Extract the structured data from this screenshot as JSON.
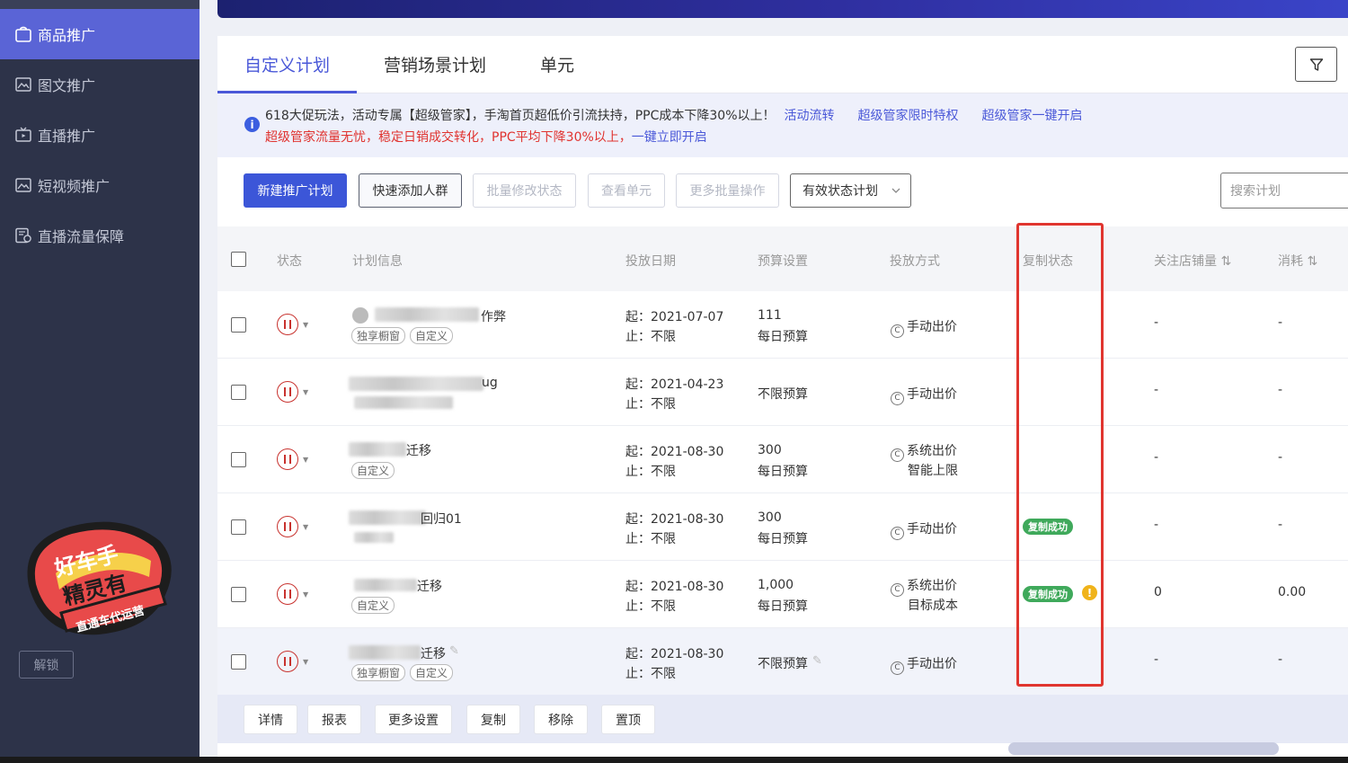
{
  "sidebar": {
    "items": [
      {
        "label": "商品推广",
        "icon": "bag-icon",
        "active": true
      },
      {
        "label": "图文推广",
        "icon": "image-icon",
        "active": false
      },
      {
        "label": "直播推广",
        "icon": "live-icon",
        "active": false
      },
      {
        "label": "短视频推广",
        "icon": "video-icon",
        "active": false
      },
      {
        "label": "直播流量保障",
        "icon": "shield-doc-icon",
        "active": false
      }
    ],
    "sticker": {
      "line1": "好车手",
      "line2": "精灵有",
      "ribbon": "直通车代运营"
    },
    "unlock_label": "解锁"
  },
  "tabs": [
    {
      "label": "自定义计划",
      "active": true
    },
    {
      "label": "营销场景计划",
      "active": false
    },
    {
      "label": "单元",
      "active": false
    }
  ],
  "notice": {
    "line1_text": "618大促玩法，活动专属【超级管家】，手淘首页超低价引流扶持，PPC成本下降30%以上！",
    "line1_links": [
      "活动流转",
      "超级管家限时特权",
      "超级管家一键开启"
    ],
    "line2_text": "超级管家流量无忧，稳定日销成交转化，PPC平均下降30%以上，",
    "line2_link": "一键立即开启"
  },
  "toolbar": {
    "new_plan": "新建推广计划",
    "quick_add": "快速添加人群",
    "batch_status": "批量修改状态",
    "view_unit": "查看单元",
    "more_batch": "更多批量操作",
    "status_filter": "有效状态计划",
    "search_placeholder": "搜索计划"
  },
  "table": {
    "headers": {
      "status": "状态",
      "plan_info": "计划信息",
      "date": "投放日期",
      "budget": "预算设置",
      "bid": "投放方式",
      "copy_status": "复制状态",
      "follow": "关注店铺量",
      "cost": "消耗"
    },
    "rows": [
      {
        "name_suffix": "作弊",
        "tags": [
          "独享橱窗",
          "自定义"
        ],
        "start": "起：2021-07-07",
        "end": "止：不限",
        "budget_amount": "111",
        "budget_type": "每日预算",
        "bid": "手动出价",
        "bid_sub": "",
        "copy_status": "",
        "warn": false,
        "follow": "-",
        "cost": "-"
      },
      {
        "name_suffix": "ug",
        "tags": [],
        "start": "起：2021-04-23",
        "end": "止：不限",
        "budget_amount": "",
        "budget_type": "不限预算",
        "bid": "手动出价",
        "bid_sub": "",
        "copy_status": "",
        "warn": false,
        "follow": "-",
        "cost": "-"
      },
      {
        "name_suffix": "迁移",
        "tags": [
          "自定义"
        ],
        "start": "起：2021-08-30",
        "end": "止：不限",
        "budget_amount": "300",
        "budget_type": "每日预算",
        "bid": "系统出价",
        "bid_sub": "智能上限",
        "copy_status": "",
        "warn": false,
        "follow": "-",
        "cost": "-"
      },
      {
        "name_suffix": "回归01",
        "tags": [],
        "start": "起：2021-08-30",
        "end": "止：不限",
        "budget_amount": "300",
        "budget_type": "每日预算",
        "bid": "手动出价",
        "bid_sub": "",
        "copy_status": "复制成功",
        "warn": false,
        "follow": "-",
        "cost": "-"
      },
      {
        "name_suffix": "迁移",
        "tags": [
          "自定义"
        ],
        "start": "起：2021-08-30",
        "end": "止：不限",
        "budget_amount": "1,000",
        "budget_type": "每日预算",
        "bid": "系统出价",
        "bid_sub": "目标成本",
        "copy_status": "复制成功",
        "warn": true,
        "follow": "0",
        "cost": "0.00"
      },
      {
        "name_suffix": "迁移",
        "tags": [
          "独享橱窗",
          "自定义"
        ],
        "start": "起：2021-08-30",
        "end": "止：不限",
        "budget_amount": "",
        "budget_type": "不限预算",
        "bid": "手动出价",
        "bid_sub": "",
        "copy_status": "",
        "warn": false,
        "follow": "-",
        "cost": "-"
      }
    ]
  },
  "row_actions": [
    "详情",
    "报表",
    "更多设置",
    "复制",
    "移除",
    "置顶"
  ],
  "colors": {
    "accent": "#4a58d8",
    "sidebar_bg": "#2d3349",
    "sidebar_active": "#5a64d6",
    "success": "#3fa95b",
    "danger": "#e0352f",
    "warning": "#f0b31a"
  }
}
